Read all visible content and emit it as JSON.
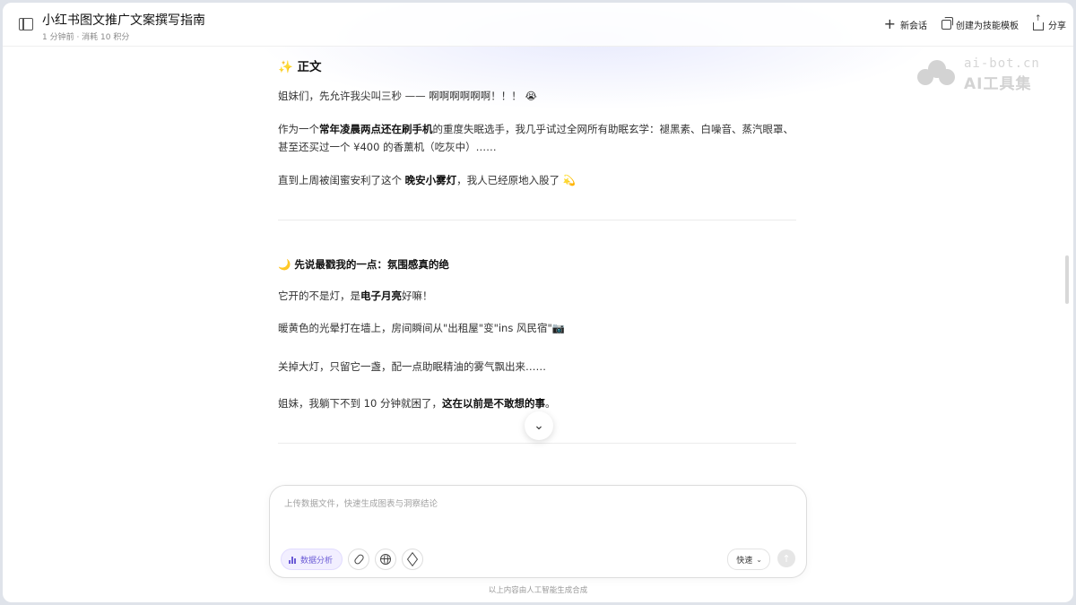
{
  "header": {
    "title": "小红书图文推广文案撰写指南",
    "meta": "1 分钟前 · 消耗 10 积分",
    "actions": [
      {
        "label": "新会话",
        "icon": "plus-icon"
      },
      {
        "label": "创建为技能模板",
        "icon": "copy-icon"
      },
      {
        "label": "分享",
        "icon": "share-icon"
      }
    ]
  },
  "watermark": {
    "url": "ai-bot.cn",
    "name": "AI工具集"
  },
  "article": {
    "section1": {
      "emoji": "✨",
      "title": "正文",
      "p1": "姐妹们，先允许我尖叫三秒 —— 啊啊啊啊啊啊！！！ 😭",
      "p2": {
        "before": "作为一个",
        "bold": "常年凌晨两点还在刷手机",
        "after": "的重度失眠选手，我几乎试过全网所有助眠玄学：褪黑素、白噪音、蒸汽眼罩、甚至还买过一个 ¥400 的香薰机（吃灰中）……"
      },
      "p3": {
        "before": "直到上周被闺蜜安利了这个 ",
        "bold": "晚安小雾灯",
        "after": "，我人已经原地入股了 💫"
      }
    },
    "section2": {
      "emoji": "🌙",
      "title": "先说最戳我的一点：氛围感真的绝",
      "p1": {
        "before": "它开的不是灯，是",
        "bold": "电子月亮",
        "after": "好嘛！"
      },
      "p2": "暖黄色的光晕打在墙上，房间瞬间从\"出租屋\"变\"ins 风民宿\"📷",
      "p3": "关掉大灯，只留它一盏，配一点助眠精油的雾气飘出来……",
      "p4": {
        "before": "姐妹，我躺下不到 10 分钟就困了，",
        "bold": "这在以前是不敢想的事",
        "after": "。"
      }
    }
  },
  "composer": {
    "placeholder": "上传数据文件，快速生成图表与洞察结论",
    "chip_label": "数据分析",
    "mode_label": "快速"
  },
  "footer": {
    "note": "以上内容由人工智能生成合成"
  }
}
